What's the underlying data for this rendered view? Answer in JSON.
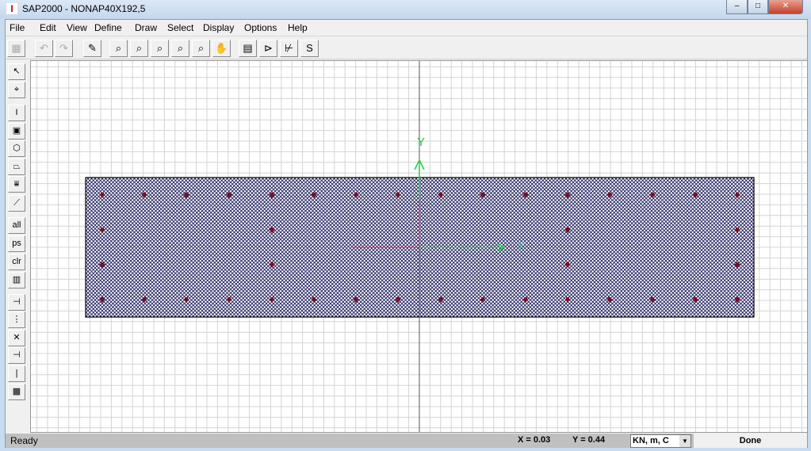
{
  "window": {
    "title": "SAP2000 - NONAP40X192,5",
    "icon": "I",
    "minimize": "‒",
    "maximize": "□",
    "close": "✕"
  },
  "menu": [
    "File",
    "Edit",
    "View",
    "Define",
    "Draw",
    "Select",
    "Display",
    "Options",
    "Help"
  ],
  "toolbar": [
    {
      "icon": "new-model-icon",
      "glyph": "▦",
      "disabled": true
    },
    {
      "icon": "undo-icon",
      "glyph": "↶",
      "disabled": true
    },
    {
      "icon": "redo-icon",
      "glyph": "↷",
      "disabled": true
    },
    {
      "icon": "pencil-icon",
      "glyph": "✎"
    },
    {
      "icon": "zoom-window-icon",
      "glyph": "⌕"
    },
    {
      "icon": "zoom-fit-icon",
      "glyph": "⌕"
    },
    {
      "icon": "zoom-previous-icon",
      "glyph": "⌕"
    },
    {
      "icon": "zoom-in-icon",
      "glyph": "⌕"
    },
    {
      "icon": "zoom-out-icon",
      "glyph": "⌕"
    },
    {
      "icon": "pan-hand-icon",
      "glyph": "✋"
    },
    {
      "icon": "table-icon",
      "glyph": "▤"
    },
    {
      "icon": "element-shape-icon",
      "glyph": "⊳"
    },
    {
      "icon": "axes-icon",
      "glyph": "⊬"
    },
    {
      "icon": "snap-icon",
      "glyph": "S"
    }
  ],
  "left_toolbar": [
    {
      "icon": "pointer-icon",
      "glyph": "↖"
    },
    {
      "icon": "reshape-icon",
      "glyph": "⌖"
    },
    {
      "icon": "draw-frame-icon",
      "glyph": "I"
    },
    {
      "icon": "draw-rect-area-icon",
      "glyph": "▣"
    },
    {
      "icon": "draw-poly-area-icon",
      "glyph": "⬡"
    },
    {
      "icon": "draw-quad-area-icon",
      "glyph": "⏢"
    },
    {
      "icon": "draw-special-joint-icon",
      "glyph": "⩸"
    },
    {
      "icon": "draw-line-icon",
      "glyph": "⟋"
    },
    {
      "icon": "select-all-icon",
      "glyph": "all"
    },
    {
      "icon": "previous-selection-icon",
      "glyph": "ps",
      "disabled": true
    },
    {
      "icon": "clear-selection-icon",
      "glyph": "clr",
      "disabled": true
    },
    {
      "icon": "intersecting-line-icon",
      "glyph": "▥"
    },
    {
      "icon": "snap-points-icon",
      "glyph": "⊣"
    },
    {
      "icon": "snap-midpoint-icon",
      "glyph": "⋮"
    },
    {
      "icon": "snap-intersection-icon",
      "glyph": "✕"
    },
    {
      "icon": "snap-perpendicular-icon",
      "glyph": "⊣"
    },
    {
      "icon": "snap-line-icon",
      "glyph": "|"
    },
    {
      "icon": "snap-grid-icon",
      "glyph": "▩"
    }
  ],
  "canvas": {
    "axis_y": "Y",
    "axis_x": "X",
    "axis_color": "#22cc44",
    "local_axis_color": "#dd2266",
    "hatch_color": "#1a1a5a",
    "joint_color": "#7a1020"
  },
  "status": {
    "left": "Ready",
    "x": "X = 0.03",
    "y": "Y = 0.44",
    "units": "KN, m, C",
    "right": "Done"
  }
}
